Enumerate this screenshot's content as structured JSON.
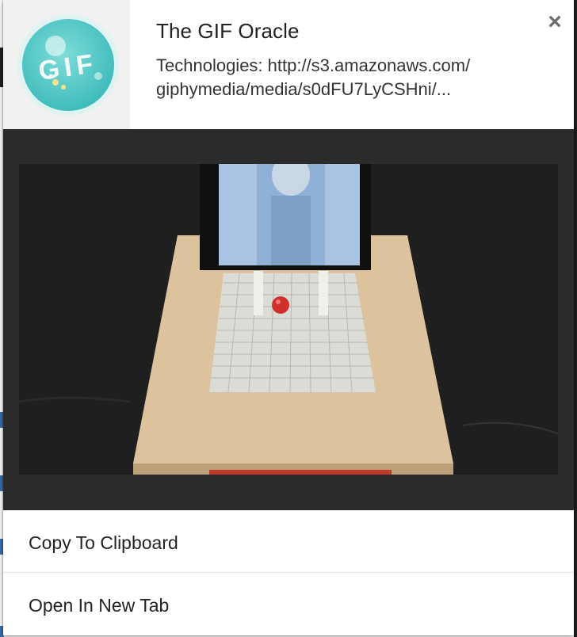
{
  "popup": {
    "logo": {
      "icon": "gif-oracle-logo",
      "text": "GIF"
    },
    "title": "The GIF Oracle",
    "subtitle_line1": "Technologies: http://s3.amazonaws.com/",
    "subtitle_line2": "giphymedia/media/s0dFU7LyCSHni/...",
    "close_label": "×",
    "media": {
      "icon": "gif-preview-image"
    },
    "menu": [
      {
        "label": "Copy To Clipboard"
      },
      {
        "label": "Open In New Tab"
      }
    ]
  },
  "colors": {
    "logo_teal": "#4ec6c6",
    "media_bg": "#2b2b2b",
    "header_bg": "#ffffff"
  }
}
